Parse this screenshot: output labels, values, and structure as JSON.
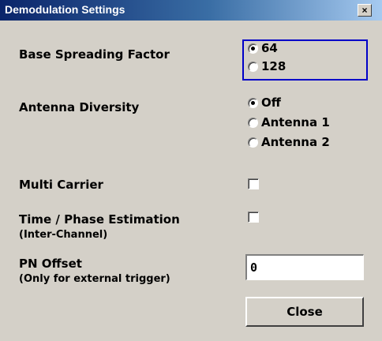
{
  "window": {
    "title": "Demodulation Settings",
    "close_glyph": "×"
  },
  "base_spreading_factor": {
    "label": "Base Spreading Factor",
    "options": [
      "64",
      "128"
    ],
    "selected": "64"
  },
  "antenna_diversity": {
    "label": "Antenna Diversity",
    "options": [
      "Off",
      "Antenna 1",
      "Antenna 2"
    ],
    "selected": "Off"
  },
  "multi_carrier": {
    "label": "Multi Carrier",
    "checked": false
  },
  "time_phase_estimation": {
    "label": "Time / Phase Estimation",
    "sublabel": "(Inter-Channel)",
    "checked": false
  },
  "pn_offset": {
    "label": "PN Offset",
    "sublabel": "(Only for external trigger)",
    "value": "0"
  },
  "close_button": {
    "label": "Close"
  },
  "colors": {
    "focus_border": "#0000c8",
    "title_bar": "#0a246a",
    "dialog_bg": "#d4d0c8"
  },
  "icons": {
    "title_close": "close-icon",
    "radio": "radio-button",
    "checkbox": "checkbox"
  }
}
